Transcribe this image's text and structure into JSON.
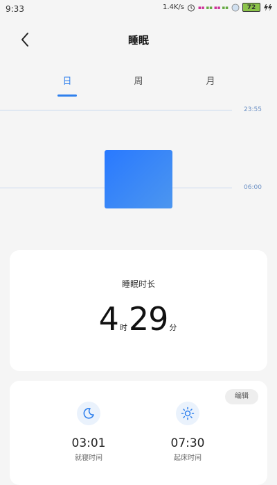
{
  "status_bar": {
    "time": "9:33",
    "speed": "1.4K/s",
    "battery": "72"
  },
  "header": {
    "title": "睡眠"
  },
  "tabs": [
    {
      "label": "日",
      "active": true
    },
    {
      "label": "周",
      "active": false
    },
    {
      "label": "月",
      "active": false
    }
  ],
  "chart": {
    "top_label": "23:55",
    "bottom_label": "06:00",
    "accent_color": "#2f80ed"
  },
  "duration": {
    "label": "睡眠时长",
    "hours": "4",
    "hours_unit": "时",
    "minutes": "29",
    "minutes_unit": "分"
  },
  "schedule": {
    "edit_label": "编辑",
    "bedtime": {
      "time": "03:01",
      "label": "就寝时间",
      "icon": "moon-icon"
    },
    "wake": {
      "time": "07:30",
      "label": "起床时间",
      "icon": "sun-icon"
    }
  }
}
